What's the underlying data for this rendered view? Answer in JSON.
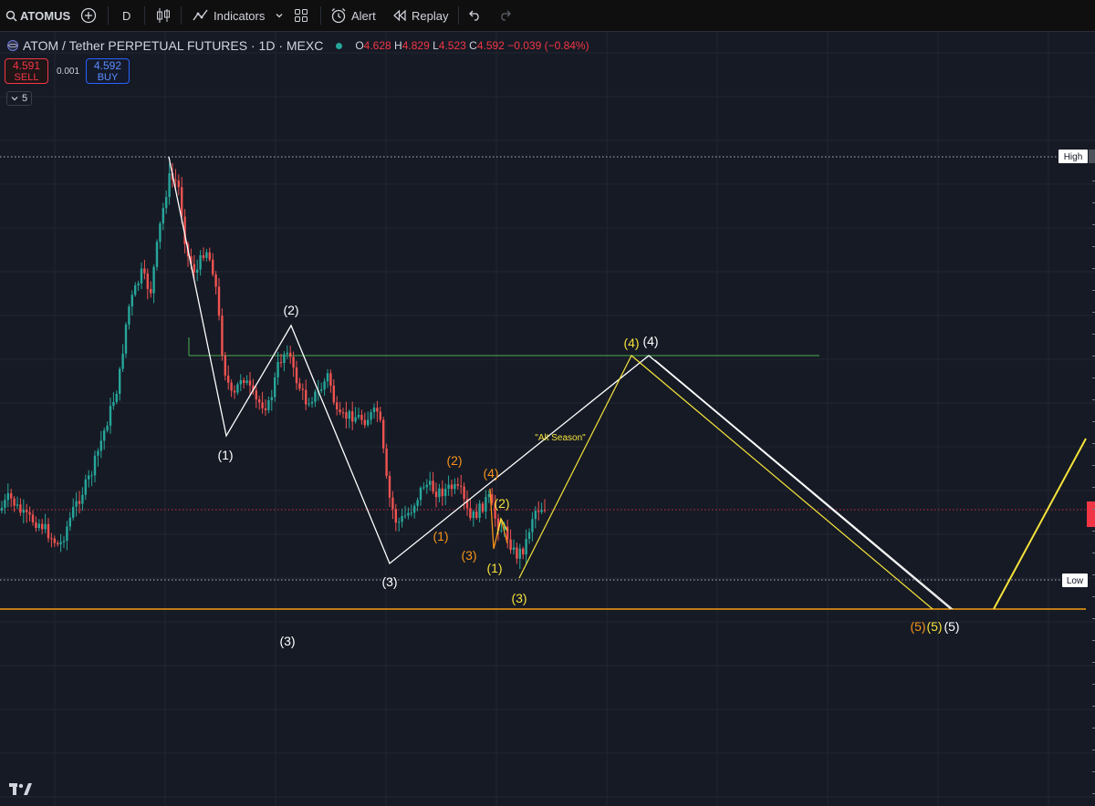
{
  "toolbar": {
    "symbol": "ATOMUS",
    "interval": "D",
    "indicators_label": "Indicators",
    "alert_label": "Alert",
    "replay_label": "Replay"
  },
  "legend": {
    "title": "ATOM / Tether PERPETUAL FUTURES · 1D · MEXC",
    "o_key": "O",
    "o_val": "4.628",
    "h_key": "H",
    "h_val": "4.829",
    "l_key": "L",
    "l_val": "4.523",
    "c_key": "C",
    "c_val": "4.592",
    "change": "−0.039 (−0.84%)"
  },
  "trade": {
    "sell_price": "4.591",
    "sell_label": "SELL",
    "spread": "0.001",
    "buy_price": "4.592",
    "buy_label": "BUY"
  },
  "collapse_count": "5",
  "price_tags": {
    "high": "High",
    "low": "Low"
  },
  "annotations": {
    "alt_season": "\"Alt Season\"",
    "w1": "(1)",
    "w2": "(2)",
    "w3": "(3)",
    "w4": "(4)",
    "w5": "(5)"
  },
  "colors": {
    "background": "#161a25",
    "bull": "#26a69a",
    "bear": "#ef5350",
    "wave_white": "#ffffff",
    "wave_orange": "#f7931a",
    "wave_yellow": "#f5e33b",
    "level_green": "#4caf50",
    "support_orange": "#f39c12"
  },
  "icons": [
    "search-icon",
    "add-symbol-icon",
    "candles-icon",
    "indicators-icon",
    "templates-icon",
    "alert-icon",
    "replay-icon",
    "undo-icon",
    "redo-icon",
    "tradingview-logo"
  ]
}
